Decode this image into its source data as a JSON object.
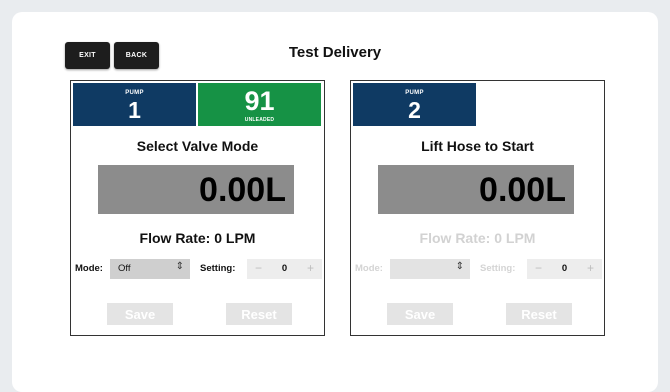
{
  "header": {
    "exit_label": "EXIT",
    "back_label": "BACK",
    "title": "Test Delivery"
  },
  "pumps": [
    {
      "pump_label": "PUMP",
      "pump_number": "1",
      "fuel_grade": "91",
      "fuel_label": "UNLEADED",
      "status": "Select Valve Mode",
      "volume": "0.00L",
      "flow_rate": "Flow Rate: 0 LPM",
      "mode_label": "Mode:",
      "mode_value": "Off",
      "setting_label": "Setting:",
      "setting_value": "0",
      "save_label": "Save",
      "reset_label": "Reset"
    },
    {
      "pump_label": "PUMP",
      "pump_number": "2",
      "status": "Lift Hose to Start",
      "volume": "0.00L",
      "flow_rate": "Flow Rate: 0 LPM",
      "mode_label": "Mode:",
      "mode_value": "",
      "setting_label": "Setting:",
      "setting_value": "0",
      "save_label": "Save",
      "reset_label": "Reset"
    }
  ],
  "colors": {
    "pump_blue": "#0f3a63",
    "fuel_green": "#169245",
    "display_gray": "#8c8c8c"
  },
  "icons": {
    "select_arrows": "up-down-chevron-icon",
    "minus": "minus-icon",
    "plus": "plus-icon"
  }
}
